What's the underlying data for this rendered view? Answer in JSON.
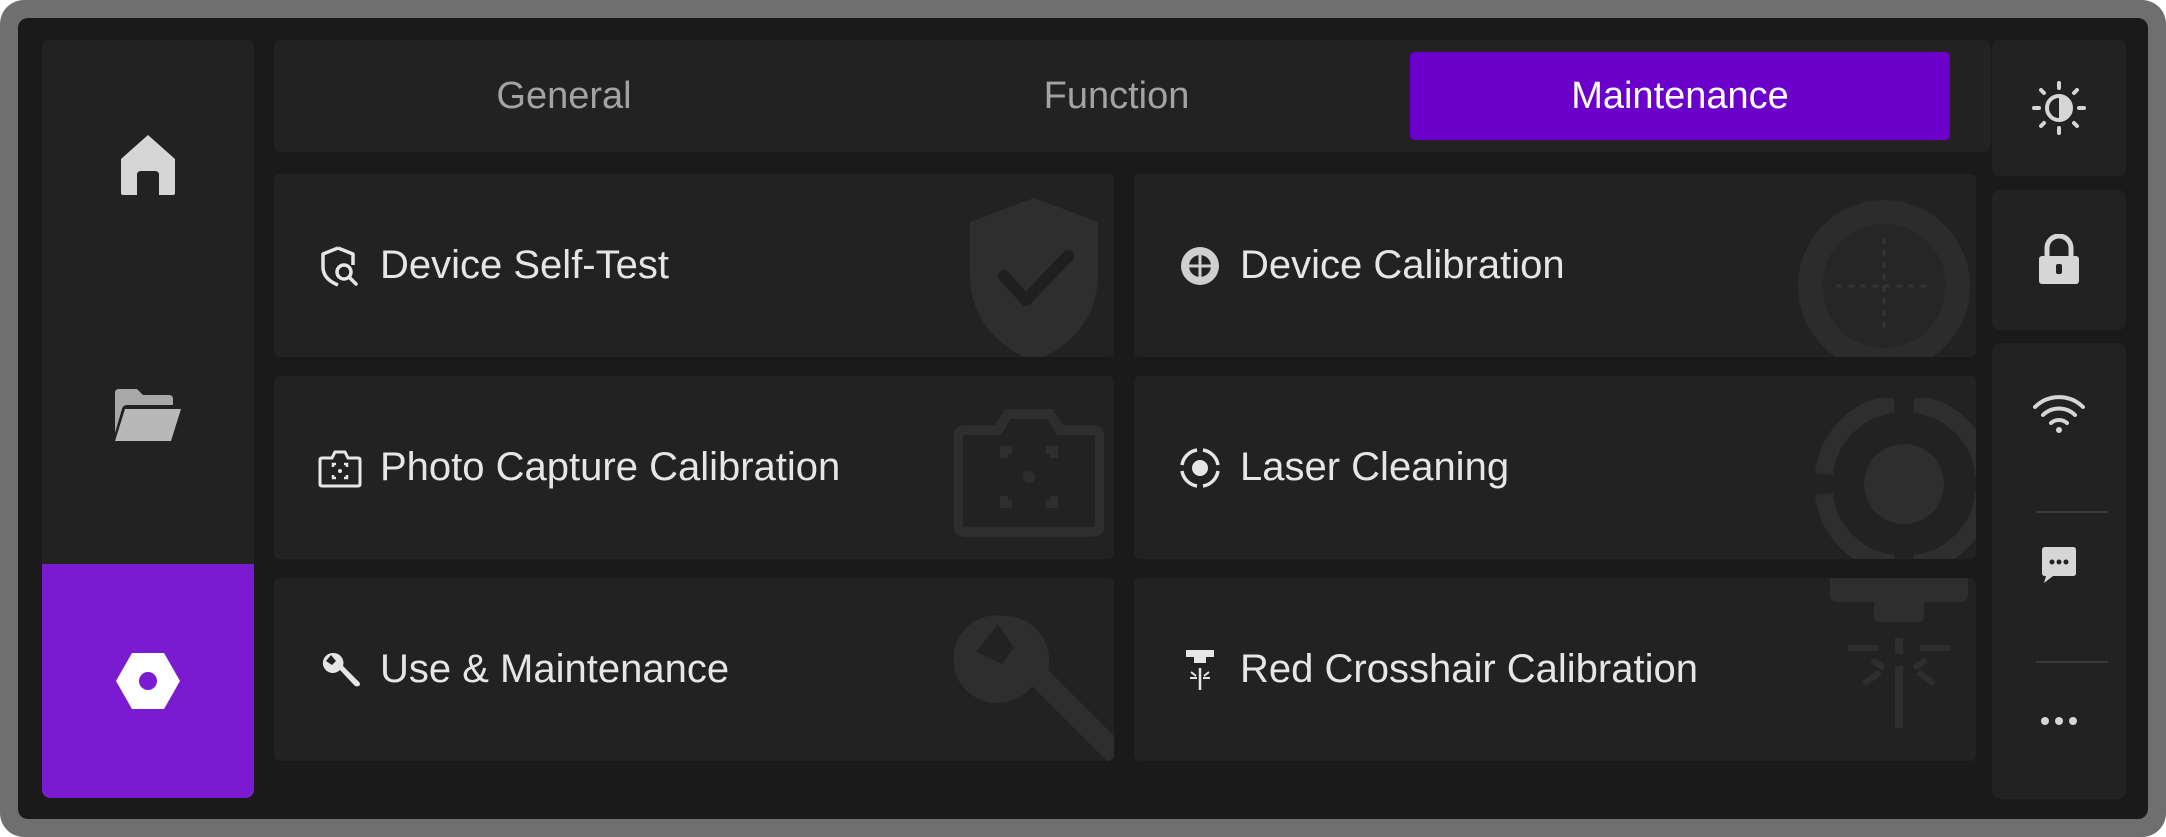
{
  "tabs": [
    {
      "label": "General",
      "active": false
    },
    {
      "label": "Function",
      "active": false
    },
    {
      "label": "Maintenance",
      "active": true
    }
  ],
  "sidebar": {
    "items": [
      {
        "icon": "home-icon",
        "active": false
      },
      {
        "icon": "folder-icon",
        "active": false
      },
      {
        "icon": "settings-icon",
        "active": true
      }
    ]
  },
  "cards": [
    {
      "label": "Device Self-Test",
      "icon": "shield-search-icon"
    },
    {
      "label": "Device Calibration",
      "icon": "target-icon"
    },
    {
      "label": "Photo Capture Calibration",
      "icon": "camera-focus-icon"
    },
    {
      "label": "Laser Cleaning",
      "icon": "laser-dot-icon"
    },
    {
      "label": "Use & Maintenance",
      "icon": "wrench-icon"
    },
    {
      "label": "Red Crosshair Calibration",
      "icon": "laser-head-icon"
    }
  ],
  "right_rail": {
    "items": [
      "brightness-icon",
      "lock-icon",
      "wifi-icon",
      "message-icon",
      "more-icon"
    ]
  },
  "colors": {
    "accent": "#6a00c9",
    "sidebar_active": "#7a1bd2",
    "panel": "#222222",
    "screen": "#1a1a1a",
    "bezel": "#6f6f6f"
  }
}
